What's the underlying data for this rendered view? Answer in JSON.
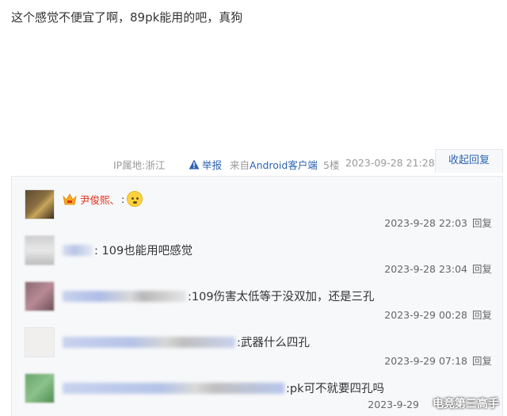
{
  "post": {
    "text": "这个感觉不便宜了啊，89pk能用的吧，真狗"
  },
  "meta": {
    "ip": "IP属地:浙江",
    "report": "举报",
    "source_prefix": "来自",
    "source_app": "Android客户端",
    "floor": "5楼",
    "time": "2023-09-28 21:28",
    "collapse": "收起回复"
  },
  "replies": [
    {
      "username": "尹俊熙、",
      "text": ":",
      "time": "2023-9-28 22:03",
      "reply_label": "回复"
    },
    {
      "text": ": 109也能用吧感觉",
      "time": "2023-9-28 23:04",
      "reply_label": "回复"
    },
    {
      "text": ":109伤害太低等于没双加，还是三孔",
      "time": "2023-9-29 00:28",
      "reply_label": "回复"
    },
    {
      "text": ":武器什么四孔",
      "time": "2023-9-29 07:18",
      "reply_label": "回复"
    },
    {
      "text": ":pk可不就要四孔吗",
      "time": "2023-9-29",
      "reply_label": "回复"
    }
  ],
  "watermark": "电竞第三高手",
  "colors": {
    "link": "#2d64b3",
    "username_red": "#e0311a",
    "reply_bg": "#f7f8fa"
  }
}
